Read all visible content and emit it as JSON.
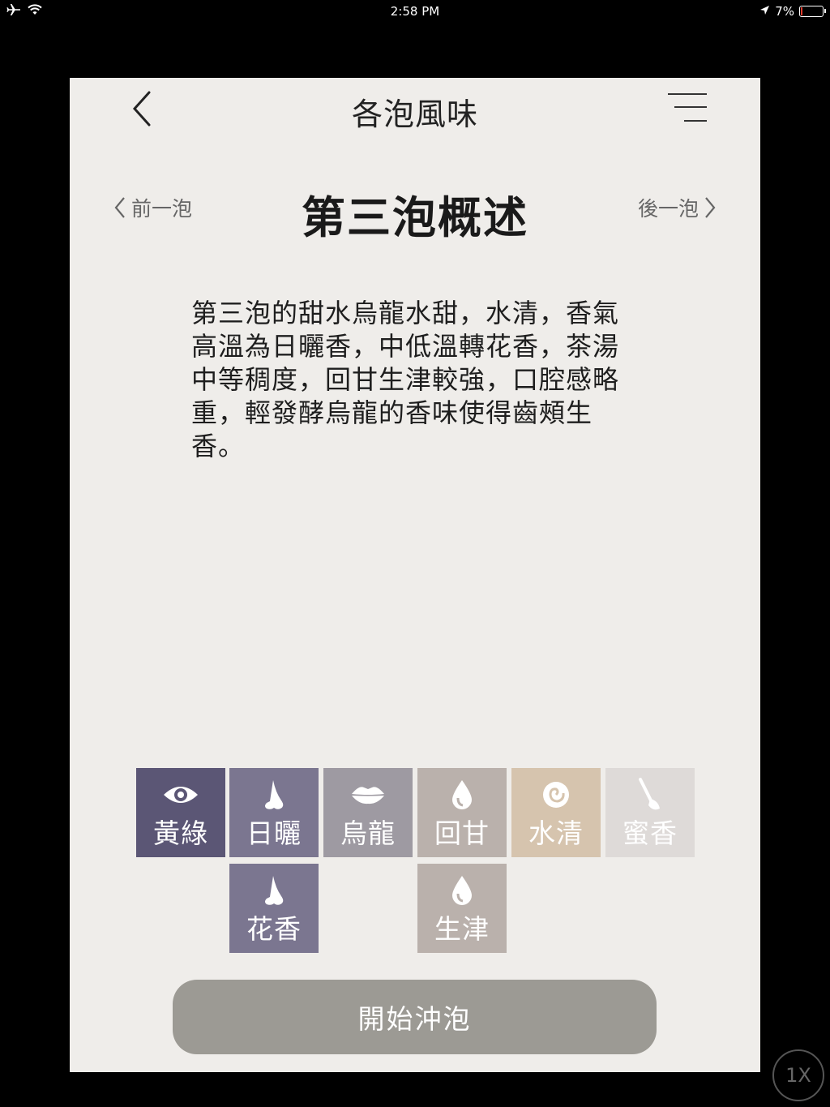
{
  "statusbar": {
    "time": "2:58 PM",
    "battery_percent": "7%",
    "battery_level": 0.07
  },
  "header": {
    "title": "各泡風味",
    "back_icon": "chevron-left-icon",
    "menu_icon": "menu-icon"
  },
  "nav": {
    "prev_label": "前一泡",
    "next_label": "後一泡",
    "section_title": "第三泡概述"
  },
  "description": "第三泡的甜水烏龍水甜，水清，香氣高溫為日曬香，中低溫轉花香，茶湯中等稠度，回甘生津較強，口腔感略重，輕發酵烏龍的香味使得齒頰生香。",
  "tiles": [
    {
      "label": "黃綠",
      "icon": "eye-icon",
      "color": "#5b5675"
    },
    {
      "label": "日曬",
      "icon": "nose-icon",
      "color": "#7b7690"
    },
    {
      "label": "烏龍",
      "icon": "lips-icon",
      "color": "#9e9aa2"
    },
    {
      "label": "回甘",
      "icon": "drop-icon",
      "color": "#bab1ac"
    },
    {
      "label": "水清",
      "icon": "swirl-icon",
      "color": "#d6c4ae"
    },
    {
      "label": "蜜香",
      "icon": "spoon-icon",
      "color": "#dedad8"
    },
    {
      "label": "花香",
      "icon": "nose-icon",
      "color": "#7b7690"
    },
    {
      "label": "生津",
      "icon": "drop-icon",
      "color": "#bab1ac"
    }
  ],
  "start_button": "開始沖泡",
  "zoom_badge": "1X"
}
